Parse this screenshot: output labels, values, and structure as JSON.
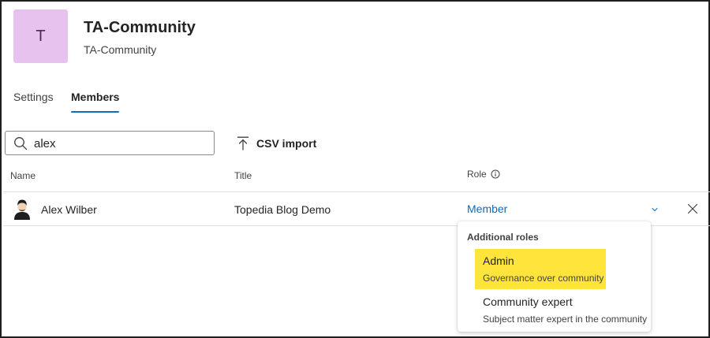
{
  "community": {
    "avatar_initial": "T",
    "title": "TA-Community",
    "subtitle": "TA-Community",
    "avatar_color": "#e7c2ee"
  },
  "tabs": [
    {
      "label": "Settings",
      "active": false
    },
    {
      "label": "Members",
      "active": true
    }
  ],
  "toolbar": {
    "search_value": "alex",
    "search_icon": "search-icon",
    "csv_import_label": "CSV import",
    "csv_import_icon": "upload-icon"
  },
  "table": {
    "columns": {
      "name": "Name",
      "title": "Title",
      "role": "Role"
    },
    "rows": [
      {
        "name": "Alex Wilber",
        "title": "Topedia Blog Demo",
        "role": "Member"
      }
    ]
  },
  "role_dropdown": {
    "header": "Additional roles",
    "options": [
      {
        "label": "Admin",
        "description": "Governance over community",
        "highlighted": true
      },
      {
        "label": "Community expert",
        "description": "Subject matter expert in the community",
        "highlighted": false
      }
    ]
  },
  "colors": {
    "accent": "#0f6cbd",
    "highlight": "#ffe53b"
  }
}
